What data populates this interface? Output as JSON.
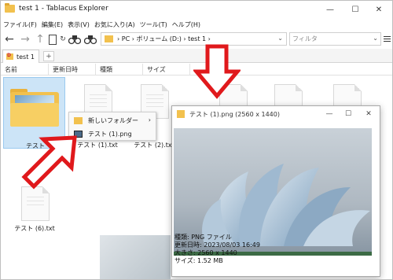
{
  "window": {
    "title": "test 1 - Tablacus Explorer"
  },
  "menu": [
    "ファイル(F)",
    "編集(E)",
    "表示(V)",
    "お気に入り(A)",
    "ツール(T)",
    "ヘルプ(H)"
  ],
  "address": {
    "path": "› PC › ボリューム (D:) › test 1 ›"
  },
  "filter": {
    "placeholder": "フィルタ"
  },
  "tabs": [
    {
      "label": "test 1"
    }
  ],
  "columns": [
    "名前",
    "更新日時",
    "種類",
    "サイズ"
  ],
  "files": [
    {
      "name": "テスト"
    },
    {
      "name": "テスト (1).txt"
    },
    {
      "name": "テスト (2).txt"
    },
    {
      "name": "テスト (6).txt"
    }
  ],
  "context_menu": {
    "items": [
      {
        "label": "新しいフォルダー",
        "icon": "folder-icon"
      },
      {
        "label": "テスト (1).png",
        "icon": "image-file-icon"
      }
    ]
  },
  "preview": {
    "title": "テスト (1).png (2560 x 1440)",
    "info": [
      "種類: PNG ファイル",
      "更新日時: 2023/08/03 16:49",
      "大きさ: 2560 x 1440",
      "サイズ: 1.52 MB"
    ]
  },
  "colors": {
    "folder": "#f2c14e",
    "selection": "#cce4f7",
    "arrow": "#e0191c"
  }
}
